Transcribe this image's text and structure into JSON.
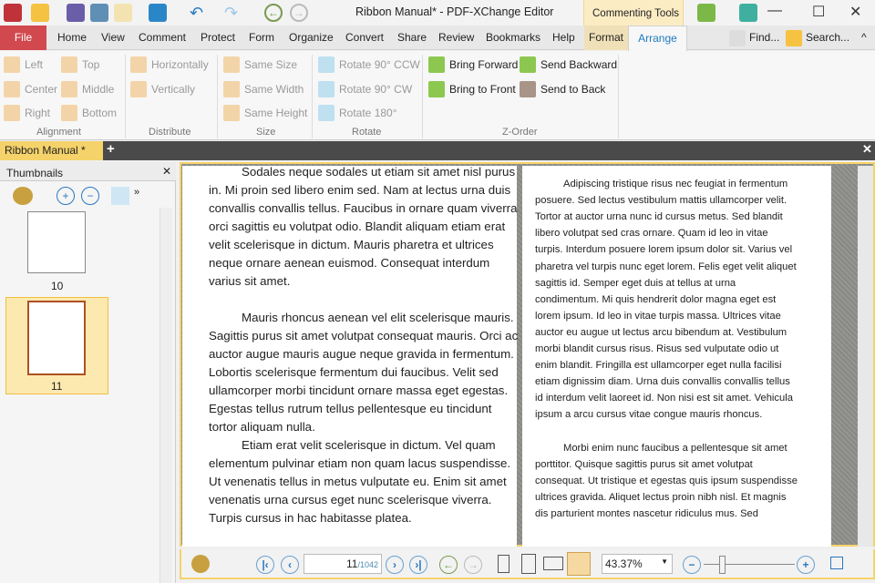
{
  "window": {
    "title": "Ribbon Manual* - PDF-XChange Editor",
    "context_group": "Commenting Tools"
  },
  "menu": {
    "file": "File",
    "tabs": [
      "Home",
      "View",
      "Comment",
      "Protect",
      "Form",
      "Organize",
      "Convert",
      "Share",
      "Review",
      "Bookmarks",
      "Help",
      "Format"
    ],
    "active": "Arrange",
    "find": "Find...",
    "search": "Search..."
  },
  "ribbon": {
    "alignment": {
      "label": "Alignment",
      "items": [
        "Left",
        "Center",
        "Right",
        "Top",
        "Middle",
        "Bottom"
      ]
    },
    "distribute": {
      "label": "Distribute",
      "items": [
        "Horizontally",
        "Vertically"
      ]
    },
    "size": {
      "label": "Size",
      "items": [
        "Same Size",
        "Same Width",
        "Same Height"
      ]
    },
    "rotate": {
      "label": "Rotate",
      "items": [
        "Rotate 90° CCW",
        "Rotate 90° CW",
        "Rotate 180°"
      ]
    },
    "zorder": {
      "label": "Z-Order",
      "items": [
        "Bring Forward",
        "Bring to Front",
        "Send Backward",
        "Send to Back"
      ]
    }
  },
  "doc_tab": "Ribbon Manual *",
  "thumbnails": {
    "title": "Thumbnails",
    "pages": [
      "10",
      "11"
    ],
    "selected": "11"
  },
  "left_page": [
    "Sodales neque sodales ut etiam sit amet nisl purus",
    "in. Mi proin sed libero enim sed. Nam at lectus urna duis",
    "convallis convallis tellus. Faucibus in ornare quam viverra",
    "orci sagittis eu volutpat odio. Blandit aliquam etiam erat",
    "velit scelerisque in dictum. Mauris pharetra et ultrices",
    "neque ornare aenean euismod. Consequat interdum",
    "varius sit amet.",
    "",
    "Mauris rhoncus aenean vel elit scelerisque mauris.",
    "Sagittis purus sit amet volutpat consequat mauris. Orci ac",
    "auctor augue mauris augue neque gravida in fermentum.",
    "Lobortis scelerisque fermentum dui faucibus. Velit sed",
    "ullamcorper morbi tincidunt ornare massa eget egestas.",
    "Egestas tellus rutrum tellus pellentesque eu tincidunt",
    "tortor aliquam nulla.",
    "Etiam erat velit scelerisque in dictum. Vel quam",
    "elementum pulvinar etiam non quam lacus suspendisse.",
    "Ut venenatis tellus in metus vulputate eu. Enim sit amet",
    "venenatis urna cursus eget nunc scelerisque viverra.",
    "Turpis cursus in hac habitasse platea."
  ],
  "right_page": [
    "Adipiscing tristique risus nec feugiat in fermentum",
    "posuere. Sed lectus vestibulum mattis ullamcorper velit.",
    "Tortor at auctor urna nunc id cursus metus. Sed blandit",
    "libero volutpat sed cras ornare. Quam id leo in vitae",
    "turpis. Interdum posuere lorem ipsum dolor sit. Varius vel",
    "pharetra vel turpis nunc eget lorem. Felis eget velit aliquet",
    "sagittis id. Semper eget duis at tellus at urna",
    "condimentum. Mi quis hendrerit dolor magna eget est",
    "lorem ipsum. Id leo in vitae turpis massa. Ultrices vitae",
    "auctor eu augue ut lectus arcu bibendum at. Vestibulum",
    "morbi blandit cursus risus. Risus sed vulputate odio ut",
    "enim blandit. Fringilla est ullamcorper eget nulla facilisi",
    "etiam dignissim diam. Urna duis convallis convallis tellus",
    "id interdum velit laoreet id. Non nisi est sit amet. Vehicula",
    "ipsum a arcu cursus vitae congue mauris rhoncus.",
    "",
    "Morbi enim nunc faucibus a pellentesque sit amet",
    "porttitor. Quisque sagittis purus sit amet volutpat",
    "consequat. Ut tristique et egestas quis ipsum suspendisse",
    "ultrices gravida. Aliquet lectus proin nibh nisl. Et magnis",
    "dis parturient montes nascetur ridiculus mus. Sed"
  ],
  "statusbar": {
    "page": "11",
    "total": "/1042",
    "zoom": "43.37%"
  }
}
